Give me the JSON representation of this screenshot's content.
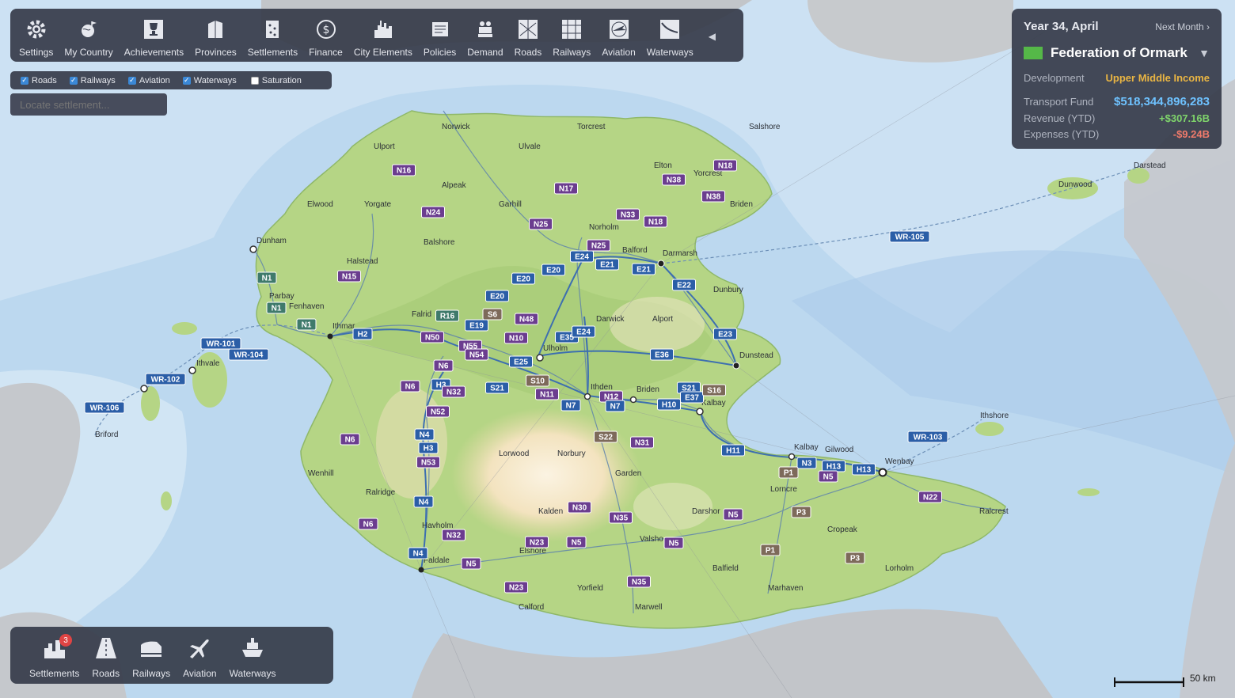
{
  "toolbar": {
    "items": [
      {
        "label": "Settings",
        "icon": "gear-icon"
      },
      {
        "label": "My Country",
        "icon": "globe-icon"
      },
      {
        "label": "Achievements",
        "icon": "trophy-icon"
      },
      {
        "label": "Provinces",
        "icon": "provinces-icon"
      },
      {
        "label": "Settlements",
        "icon": "settlements-icon"
      },
      {
        "label": "Finance",
        "icon": "dollar-icon"
      },
      {
        "label": "City Elements",
        "icon": "city-elements-icon"
      },
      {
        "label": "Policies",
        "icon": "policies-icon"
      },
      {
        "label": "Demand",
        "icon": "demand-icon"
      },
      {
        "label": "Roads",
        "icon": "roads-icon"
      },
      {
        "label": "Railways",
        "icon": "railways-icon"
      },
      {
        "label": "Aviation",
        "icon": "aviation-icon"
      },
      {
        "label": "Waterways",
        "icon": "waterways-icon"
      }
    ],
    "collapse_icon": "triangle-left-icon"
  },
  "filters": [
    {
      "label": "Roads",
      "checked": true
    },
    {
      "label": "Railways",
      "checked": true
    },
    {
      "label": "Aviation",
      "checked": true
    },
    {
      "label": "Waterways",
      "checked": true
    },
    {
      "label": "Saturation",
      "checked": false
    }
  ],
  "search": {
    "placeholder": "Locate settlement..."
  },
  "info": {
    "date": "Year 34, April",
    "next_month": "Next Month ›",
    "country": "Federation of Ormark",
    "flag_color": "#55b848",
    "development_label": "Development",
    "development_value": "Upper Middle Income",
    "fund_label": "Transport Fund",
    "fund_value": "$518,344,896,283",
    "revenue_label": "Revenue (YTD)",
    "revenue_value": "+$307.16B",
    "expenses_label": "Expenses (YTD)",
    "expenses_value": "-$9.24B"
  },
  "bottom_bar": {
    "items": [
      {
        "label": "Settlements",
        "icon": "settlements-icon",
        "badge": "3"
      },
      {
        "label": "Roads",
        "icon": "road-icon"
      },
      {
        "label": "Railways",
        "icon": "train-icon"
      },
      {
        "label": "Aviation",
        "icon": "plane-icon"
      },
      {
        "label": "Waterways",
        "icon": "ship-icon"
      }
    ]
  },
  "scale_label": "50 km",
  "map": {
    "colors": {
      "sea_deep": "#b4d3ee",
      "sea_shallow": "#d6e7f4",
      "land": "#b4d483",
      "land_dark": "#9fc86e",
      "foreign": "#bcbfc4",
      "route_blue": "#2b5ea7",
      "route_purple": "#6b3d8f"
    },
    "places": [
      {
        "name": "Norwick",
        "cls": "city"
      },
      {
        "name": "Torcrest",
        "cls": "city"
      },
      {
        "name": "Salshore",
        "cls": "city"
      },
      {
        "name": "Ulport",
        "cls": "city"
      },
      {
        "name": "Ulvale",
        "cls": "city"
      },
      {
        "name": "Elton",
        "cls": "city"
      },
      {
        "name": "Yorcrest",
        "cls": "city"
      },
      {
        "name": "Alpeak",
        "cls": "city"
      },
      {
        "name": "Garhill",
        "cls": "city"
      },
      {
        "name": "Elwood",
        "cls": "city"
      },
      {
        "name": "Yorgate",
        "cls": "city"
      },
      {
        "name": "Norholm",
        "cls": "city"
      },
      {
        "name": "Briden",
        "cls": "city"
      },
      {
        "name": "Dunham",
        "cls": "city"
      },
      {
        "name": "Balshore",
        "cls": "city"
      },
      {
        "name": "Halstead",
        "cls": "city"
      },
      {
        "name": "Balford",
        "cls": "city"
      },
      {
        "name": "Darmarsh",
        "cls": "city"
      },
      {
        "name": "Parbay",
        "cls": "city"
      },
      {
        "name": "Fenhaven",
        "cls": "city"
      },
      {
        "name": "Dunbury",
        "cls": "city"
      },
      {
        "name": "Ithmar",
        "cls": "city"
      },
      {
        "name": "Falrid",
        "cls": "city"
      },
      {
        "name": "Darwick",
        "cls": "city"
      },
      {
        "name": "Alport",
        "cls": "city"
      },
      {
        "name": "Ulholm",
        "cls": "city"
      },
      {
        "name": "Dunstead",
        "cls": "city"
      },
      {
        "name": "Ithvale",
        "cls": "city"
      },
      {
        "name": "Ithden",
        "cls": "city"
      },
      {
        "name": "Briden",
        "cls": "city"
      },
      {
        "name": "Kalbay",
        "cls": "city"
      },
      {
        "name": "Briford",
        "cls": "city"
      },
      {
        "name": "Norbury",
        "cls": "city"
      },
      {
        "name": "Lorwood",
        "cls": "city"
      },
      {
        "name": "Wenhill",
        "cls": "city"
      },
      {
        "name": "Garden",
        "cls": "city"
      },
      {
        "name": "Ralridge",
        "cls": "city"
      },
      {
        "name": "Kalbay",
        "cls": "city"
      },
      {
        "name": "Gilwood",
        "cls": "city"
      },
      {
        "name": "Wenbay",
        "cls": "city"
      },
      {
        "name": "Ithshore",
        "cls": "city"
      },
      {
        "name": "Lorncre",
        "cls": "city"
      },
      {
        "name": "Kalden",
        "cls": "city"
      },
      {
        "name": "Darshor",
        "cls": "city"
      },
      {
        "name": "Havholm",
        "cls": "city"
      },
      {
        "name": "Ralcrest",
        "cls": "city"
      },
      {
        "name": "Cropeak",
        "cls": "city"
      },
      {
        "name": "Valsho",
        "cls": "city"
      },
      {
        "name": "Elshore",
        "cls": "city"
      },
      {
        "name": "Faldale",
        "cls": "city"
      },
      {
        "name": "Balfield",
        "cls": "city"
      },
      {
        "name": "Lorholm",
        "cls": "city"
      },
      {
        "name": "Yorfield",
        "cls": "city"
      },
      {
        "name": "Marhaven",
        "cls": "city"
      },
      {
        "name": "Calford",
        "cls": "city"
      },
      {
        "name": "Marwell",
        "cls": "city"
      },
      {
        "name": "Darstead",
        "cls": "city"
      },
      {
        "name": "Dunwood",
        "cls": "city"
      }
    ],
    "route_labels": [
      {
        "id": "N16",
        "kind": "n"
      },
      {
        "id": "N17",
        "kind": "n"
      },
      {
        "id": "N18",
        "kind": "n"
      },
      {
        "id": "N38",
        "kind": "n"
      },
      {
        "id": "N38",
        "kind": "n"
      },
      {
        "id": "N24",
        "kind": "n"
      },
      {
        "id": "N33",
        "kind": "n"
      },
      {
        "id": "N18",
        "kind": "n"
      },
      {
        "id": "N25",
        "kind": "n"
      },
      {
        "id": "N25",
        "kind": "n"
      },
      {
        "id": "E24",
        "kind": "e"
      },
      {
        "id": "E21",
        "kind": "e"
      },
      {
        "id": "E21",
        "kind": "e"
      },
      {
        "id": "E20",
        "kind": "e"
      },
      {
        "id": "E20",
        "kind": "e"
      },
      {
        "id": "E22",
        "kind": "e"
      },
      {
        "id": "N1",
        "kind": "h"
      },
      {
        "id": "N15",
        "kind": "n"
      },
      {
        "id": "N1",
        "kind": "h"
      },
      {
        "id": "N1",
        "kind": "h"
      },
      {
        "id": "E20",
        "kind": "e"
      },
      {
        "id": "S6",
        "kind": "s"
      },
      {
        "id": "N48",
        "kind": "n"
      },
      {
        "id": "R16",
        "kind": "h"
      },
      {
        "id": "H2",
        "kind": "e"
      },
      {
        "id": "E19",
        "kind": "e"
      },
      {
        "id": "N50",
        "kind": "n"
      },
      {
        "id": "N10",
        "kind": "n"
      },
      {
        "id": "E35",
        "kind": "e"
      },
      {
        "id": "E24",
        "kind": "e"
      },
      {
        "id": "E23",
        "kind": "e"
      },
      {
        "id": "N55",
        "kind": "n"
      },
      {
        "id": "N54",
        "kind": "n"
      },
      {
        "id": "E25",
        "kind": "e"
      },
      {
        "id": "E36",
        "kind": "e"
      },
      {
        "id": "N6",
        "kind": "n"
      },
      {
        "id": "WR-101",
        "kind": "e"
      },
      {
        "id": "WR-104",
        "kind": "e"
      },
      {
        "id": "WR-102",
        "kind": "e"
      },
      {
        "id": "WR-106",
        "kind": "e"
      },
      {
        "id": "N6",
        "kind": "n"
      },
      {
        "id": "H3",
        "kind": "e"
      },
      {
        "id": "N32",
        "kind": "n"
      },
      {
        "id": "S21",
        "kind": "e"
      },
      {
        "id": "S10",
        "kind": "s"
      },
      {
        "id": "N11",
        "kind": "n"
      },
      {
        "id": "N7",
        "kind": "e"
      },
      {
        "id": "N12",
        "kind": "n"
      },
      {
        "id": "N7",
        "kind": "e"
      },
      {
        "id": "S21",
        "kind": "e"
      },
      {
        "id": "E37",
        "kind": "e"
      },
      {
        "id": "S16",
        "kind": "s"
      },
      {
        "id": "H10",
        "kind": "e"
      },
      {
        "id": "N52",
        "kind": "n"
      },
      {
        "id": "N6",
        "kind": "n"
      },
      {
        "id": "N4",
        "kind": "e"
      },
      {
        "id": "H3",
        "kind": "e"
      },
      {
        "id": "N53",
        "kind": "n"
      },
      {
        "id": "S22",
        "kind": "s"
      },
      {
        "id": "N31",
        "kind": "n"
      },
      {
        "id": "H11",
        "kind": "e"
      },
      {
        "id": "N3",
        "kind": "e"
      },
      {
        "id": "H13",
        "kind": "e"
      },
      {
        "id": "H13",
        "kind": "e"
      },
      {
        "id": "P1",
        "kind": "s"
      },
      {
        "id": "N5",
        "kind": "n"
      },
      {
        "id": "WR-103",
        "kind": "e"
      },
      {
        "id": "N22",
        "kind": "n"
      },
      {
        "id": "N4",
        "kind": "e"
      },
      {
        "id": "N30",
        "kind": "n"
      },
      {
        "id": "N35",
        "kind": "n"
      },
      {
        "id": "N5",
        "kind": "n"
      },
      {
        "id": "P3",
        "kind": "s"
      },
      {
        "id": "N6",
        "kind": "n"
      },
      {
        "id": "N32",
        "kind": "n"
      },
      {
        "id": "N23",
        "kind": "n"
      },
      {
        "id": "N5",
        "kind": "n"
      },
      {
        "id": "N5",
        "kind": "n"
      },
      {
        "id": "P1",
        "kind": "s"
      },
      {
        "id": "P3",
        "kind": "s"
      },
      {
        "id": "N4",
        "kind": "e"
      },
      {
        "id": "N5",
        "kind": "n"
      },
      {
        "id": "N35",
        "kind": "n"
      },
      {
        "id": "N23",
        "kind": "n"
      },
      {
        "id": "WR-105",
        "kind": "e"
      }
    ]
  }
}
